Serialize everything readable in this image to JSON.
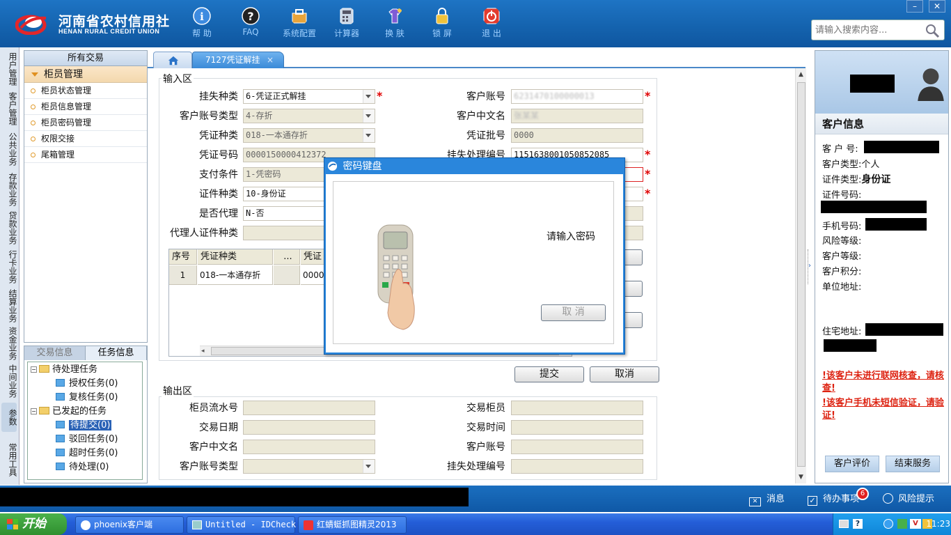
{
  "header": {
    "logo_cn": "河南省农村信用社",
    "logo_en": "HENAN RURAL CREDIT UNION",
    "toolbar": [
      {
        "label": "帮 助",
        "icon": "info-icon"
      },
      {
        "label": "FAQ",
        "icon": "help-icon"
      },
      {
        "label": "系统配置",
        "icon": "toolbox-icon"
      },
      {
        "label": "计算器",
        "icon": "calculator-icon"
      },
      {
        "label": "换 肤",
        "icon": "shirt-icon"
      },
      {
        "label": "锁 屏",
        "icon": "lock-icon"
      },
      {
        "label": "退 出",
        "icon": "power-icon"
      }
    ],
    "search_placeholder": "请输入搜索内容...",
    "win_min": "–",
    "win_close": "✕"
  },
  "vnav": [
    "用户管理",
    "客户管理",
    "公共业务",
    "存款业务",
    "贷款业务",
    "行卡业务",
    "结算业务",
    "资金业务",
    "中间业务",
    "参数",
    "常用工具"
  ],
  "left_panel": {
    "title": "所有交易",
    "group": "柜员管理",
    "items": [
      "柜员状态管理",
      "柜员信息管理",
      "柜员密码管理",
      "权限交接",
      "尾箱管理"
    ]
  },
  "task_panel": {
    "tabs": [
      "交易信息",
      "任务信息"
    ],
    "tree": [
      {
        "label": "待处理任务",
        "level": 0
      },
      {
        "label": "授权任务(0)",
        "level": 1
      },
      {
        "label": "复核任务(0)",
        "level": 1
      },
      {
        "label": "已发起的任务",
        "level": 0
      },
      {
        "label": "待提交(0)",
        "level": 1,
        "selected": true
      },
      {
        "label": "驳回任务(0)",
        "level": 1
      },
      {
        "label": "超时任务(0)",
        "level": 1
      },
      {
        "label": "待处理(0)",
        "level": 1
      }
    ]
  },
  "tabs": {
    "active": "7127凭证解挂",
    "close": "×"
  },
  "input_area": {
    "title": "输入区",
    "left": [
      {
        "label": "挂失种类",
        "value": "6-凭证正式解挂"
      },
      {
        "label": "客户账号类型",
        "value": "4-存折"
      },
      {
        "label": "凭证种类",
        "value": "018-一本通存折"
      },
      {
        "label": "凭证号码",
        "value": "0000150000412372"
      },
      {
        "label": "支付条件",
        "value": "1-凭密码"
      },
      {
        "label": "证件种类",
        "value": "10-身份证"
      },
      {
        "label": "是否代理",
        "value": "N-否"
      },
      {
        "label": "代理人证件种类",
        "value": ""
      }
    ],
    "right": [
      {
        "label": "客户账号",
        "value": "6231470100000013"
      },
      {
        "label": "客户中文名",
        "value": "张某某"
      },
      {
        "label": "凭证批号",
        "value": "0000"
      },
      {
        "label": "挂失处理编号",
        "value": "1151638001050852085"
      }
    ],
    "required_mark": "*",
    "grid": {
      "headers": [
        "序号",
        "凭证种类",
        "...",
        "凭证"
      ],
      "row": {
        "no": "1",
        "type": "018-一本通存折",
        "c3": "",
        "c4": "0000"
      }
    },
    "submit": "提交",
    "cancel": "取消"
  },
  "output_area": {
    "title": "输出区",
    "left": [
      "柜员流水号",
      "交易日期",
      "客户中文名",
      "客户账号类型"
    ],
    "right": [
      "交易柜员",
      "交易时间",
      "客户账号",
      "挂失处理编号"
    ]
  },
  "dialog": {
    "title": "密码键盘",
    "prompt": "请输入密码",
    "cancel": "取 消"
  },
  "right_panel": {
    "section": "客户信息",
    "fields": [
      {
        "label": "客 户 号:",
        "value": ""
      },
      {
        "label": "客户类型:",
        "value": "个人"
      },
      {
        "label": "证件类型:",
        "value": "身份证"
      },
      {
        "label": "证件号码:",
        "value": ""
      },
      {
        "label": "手机号码:",
        "value": ""
      },
      {
        "label": "风险等级:",
        "value": ""
      },
      {
        "label": "客户等级:",
        "value": ""
      },
      {
        "label": "客户积分:",
        "value": ""
      },
      {
        "label": "单位地址:",
        "value": ""
      },
      {
        "label": "住宅地址:",
        "value": ""
      }
    ],
    "warnings": [
      "!该客户未进行联网核查，请核查!",
      "!该客户手机未短信验证，请验证!"
    ],
    "btn_eval": "客户评价",
    "btn_end": "结束服务"
  },
  "status": {
    "messages": "消息",
    "todo": "待办事项",
    "todo_count": "6",
    "risk": "风险提示"
  },
  "taskbar": {
    "start": "开始",
    "tasks": [
      "phoenix客户端",
      "Untitled - IDCheck",
      "红蜻蜓抓图精灵2013"
    ],
    "clock": "11:23"
  }
}
